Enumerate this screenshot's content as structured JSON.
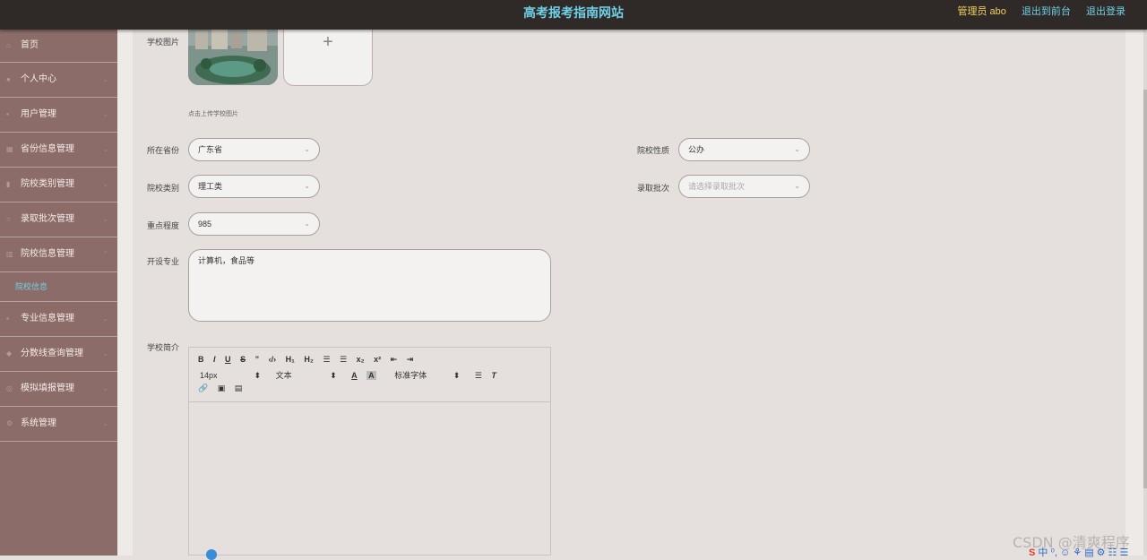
{
  "header": {
    "title": "高考报考指南网站",
    "admin_label": "管理员 abo",
    "back_label": "退出到前台",
    "logout_label": "退出登录"
  },
  "sidebar": {
    "items": [
      {
        "label": "首页"
      },
      {
        "label": "个人中心"
      },
      {
        "label": "用户管理"
      },
      {
        "label": "省份信息管理"
      },
      {
        "label": "院校类别管理"
      },
      {
        "label": "录取批次管理"
      },
      {
        "label": "院校信息管理"
      },
      {
        "label": "专业信息管理"
      },
      {
        "label": "分数线查询管理"
      },
      {
        "label": "模拟填报管理"
      },
      {
        "label": "系统管理"
      }
    ],
    "active_sub": "院校信息"
  },
  "form": {
    "image_label": "学校图片",
    "upload_plus": "+",
    "upload_hint": "点击上传学校图片",
    "province_label": "所在省份",
    "province_value": "广东省",
    "nature_label": "院校性质",
    "nature_value": "公办",
    "category_label": "院校类别",
    "category_value": "理工类",
    "batch_label": "录取批次",
    "batch_placeholder": "请选择录取批次",
    "level_label": "重点程度",
    "level_value": "985",
    "majors_label": "开设专业",
    "majors_value": "计算机，食品等",
    "intro_label": "学校简介"
  },
  "editor": {
    "row1": [
      "B",
      "I",
      "U",
      "S",
      "”",
      "‹/›",
      "H₁",
      "H₂",
      "☰",
      "☰",
      "x₂",
      "x²",
      "⇤",
      "⇥"
    ],
    "font_size": "14px",
    "text_style": "文本",
    "font_family": "标准字体",
    "row3": [
      "🔗",
      "▣",
      "▤"
    ]
  },
  "watermark": "CSDN @清爽程序",
  "ime": "中 ⁰, ☺ ⚘ ▤ ⚙ ☷ ☰"
}
